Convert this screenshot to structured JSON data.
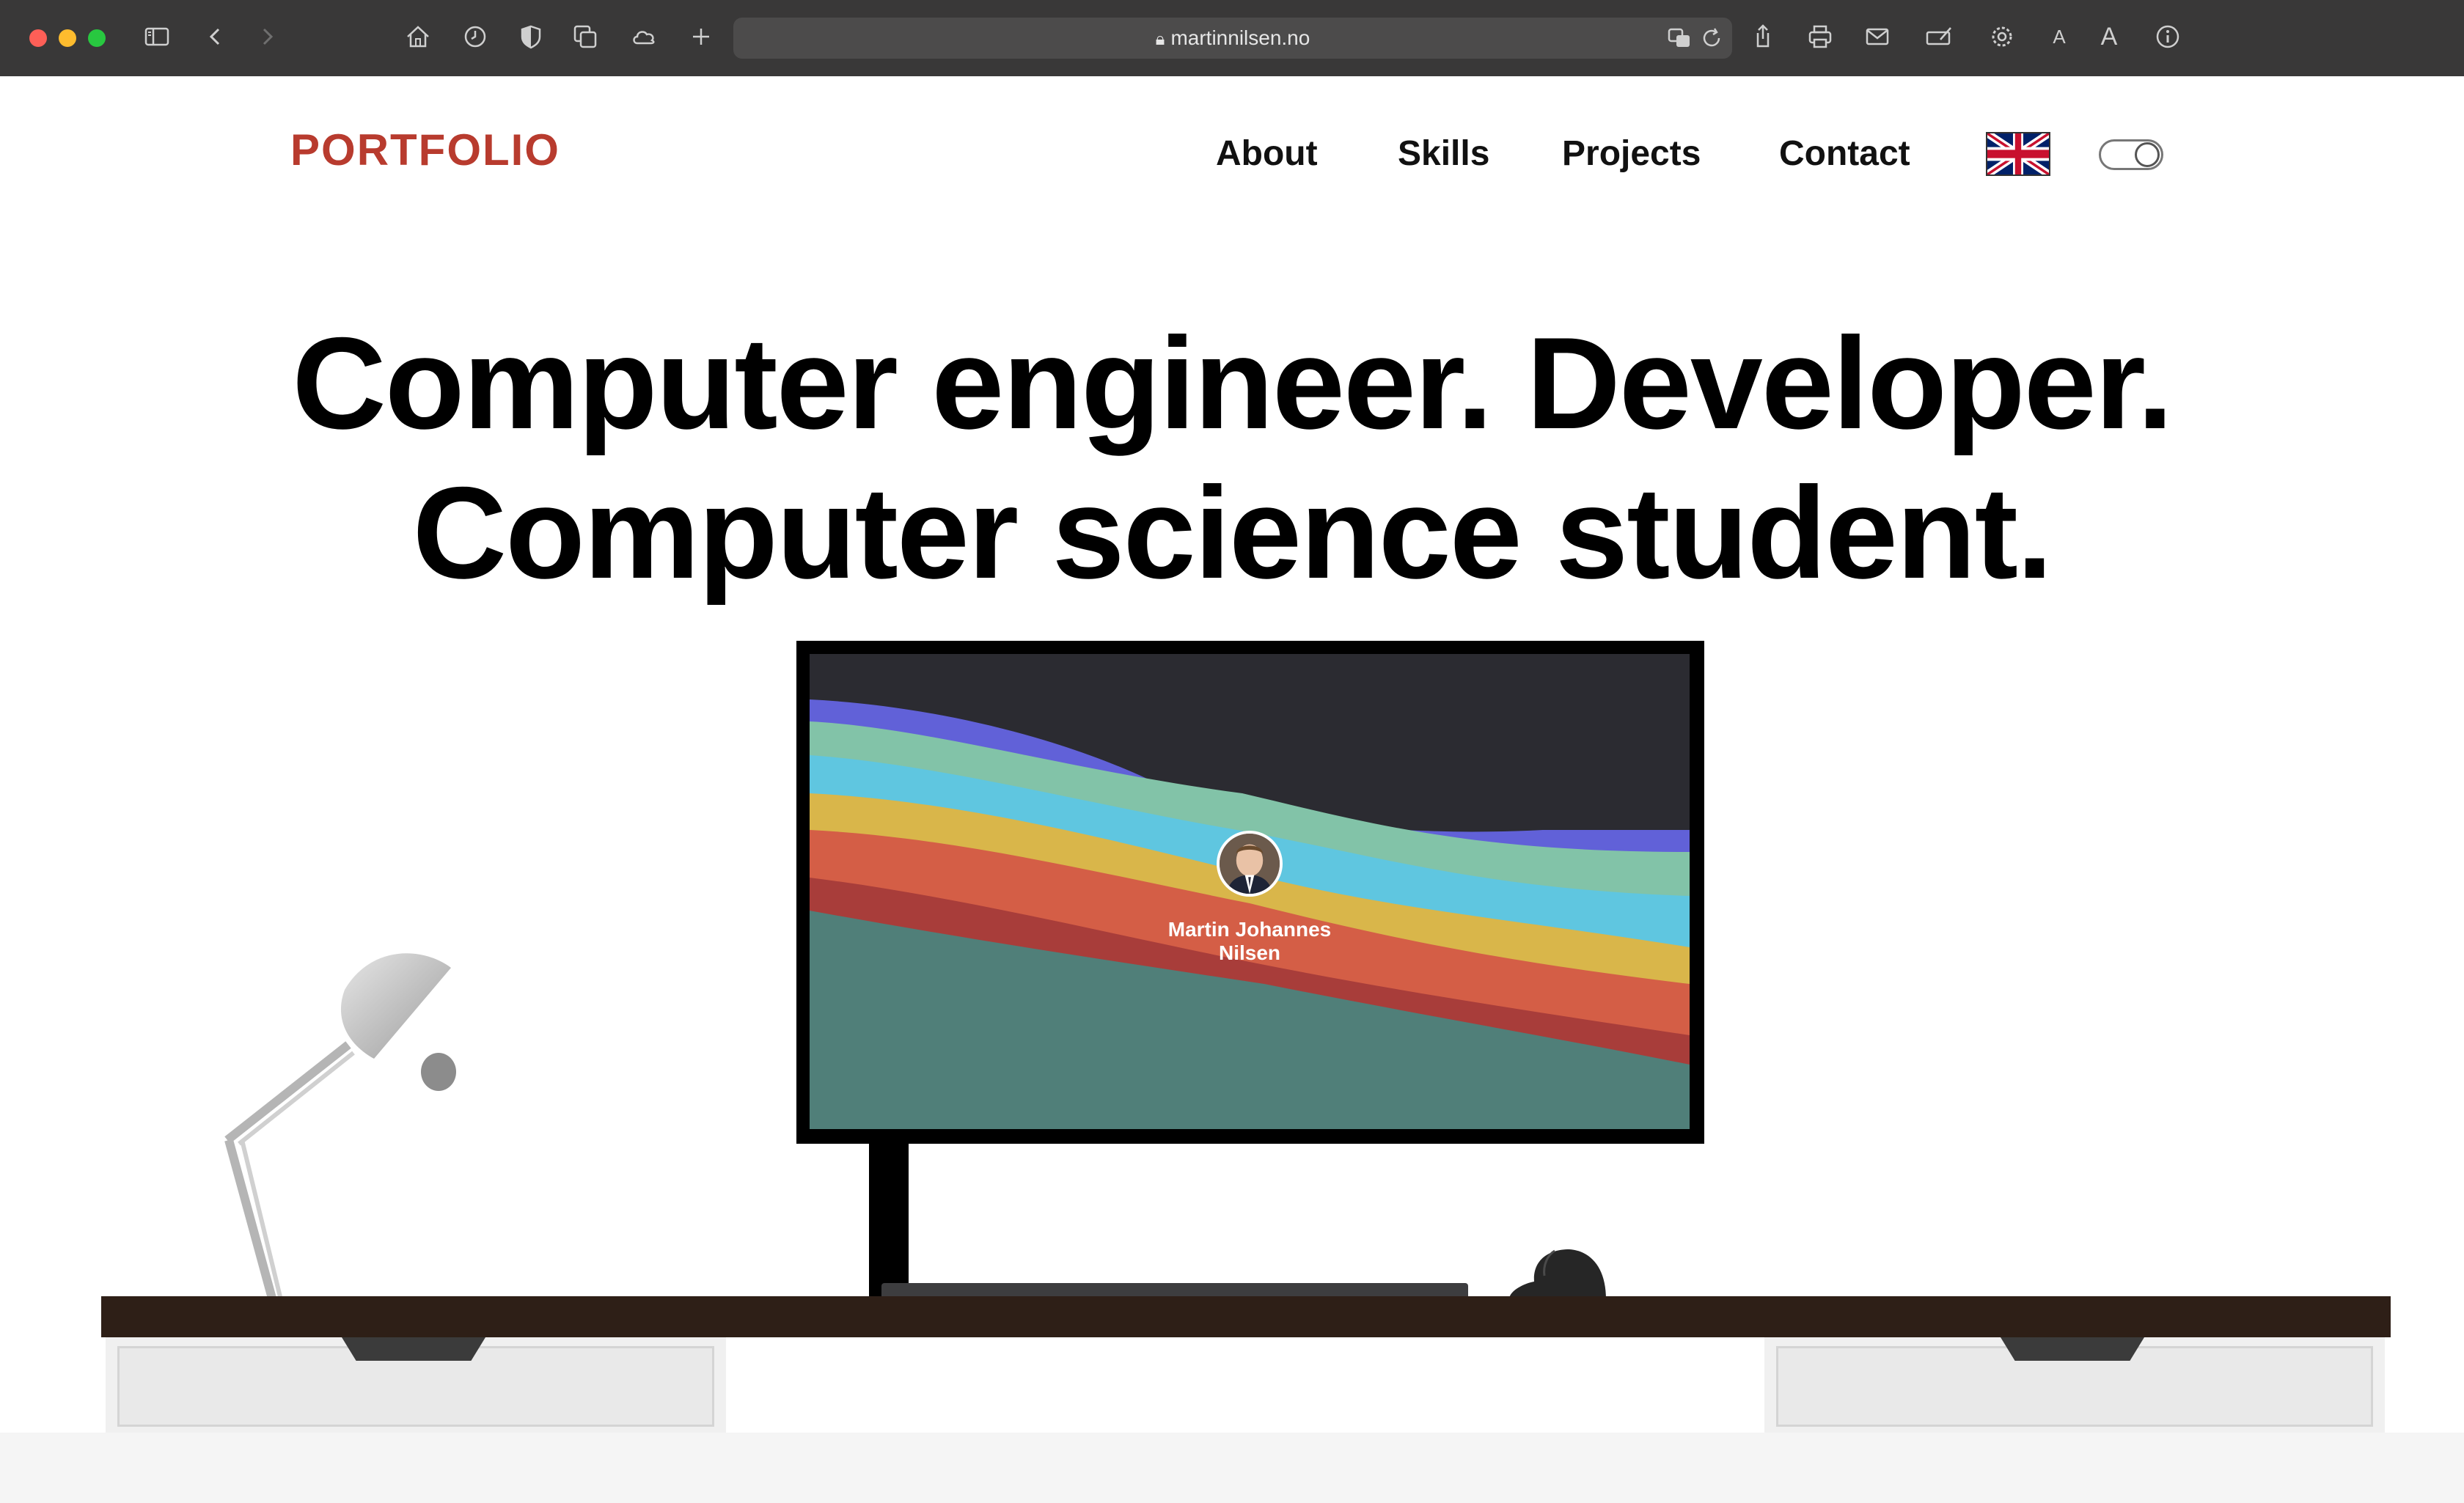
{
  "browser": {
    "url": "martinnilsen.no",
    "icons": [
      "sidebar-icon",
      "back-icon",
      "forward-icon",
      "home-icon",
      "history-icon",
      "shield-icon",
      "tabs-icon",
      "cloud-icon",
      "new-tab-icon",
      "translate-icon",
      "reload-icon",
      "share-icon",
      "print-icon",
      "mail-icon",
      "markup-icon",
      "settings-icon",
      "text-smaller-icon",
      "text-larger-icon",
      "info-icon"
    ],
    "text_small": "A",
    "text_large": "A"
  },
  "site": {
    "logo": "PORTFOLIO",
    "nav": [
      "About",
      "Skills",
      "Projects",
      "Contact"
    ],
    "language_flag": "uk-flag-icon",
    "theme_toggle": "theme-toggle"
  },
  "hero": {
    "line1": "Computer engineer. Developer.",
    "line2": "Computer science student."
  },
  "monitor": {
    "name_line1": "Martin Johannes",
    "name_line2": "Nilsen"
  },
  "colors": {
    "logo": "#b83b2e",
    "wave_purple": "#6161d8",
    "wave_green": "#82c3a8",
    "wave_cyan": "#5fc6e0",
    "wave_yellow": "#d9b64a",
    "wave_orange": "#d45e46",
    "wave_red": "#a83d3a",
    "wave_teal": "#507f79",
    "desk": "#2e1f17"
  }
}
